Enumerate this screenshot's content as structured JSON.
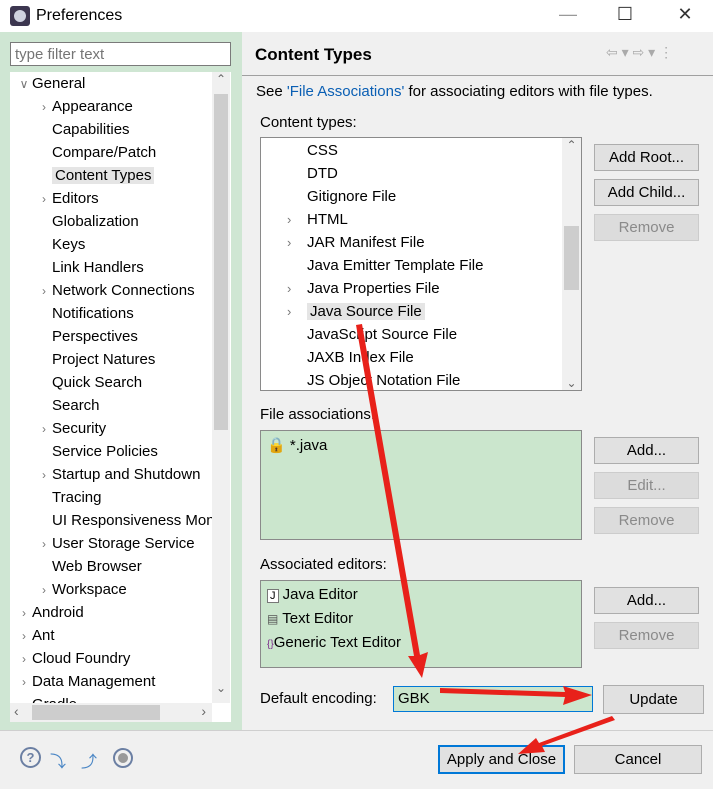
{
  "window": {
    "title": "Preferences",
    "minimize": "—",
    "maximize": "☐",
    "close": "✕"
  },
  "filter": {
    "placeholder": "type filter text"
  },
  "tree": [
    {
      "label": "General",
      "level": 0,
      "exp": "open"
    },
    {
      "label": "Appearance",
      "level": 1,
      "exp": "closed"
    },
    {
      "label": "Capabilities",
      "level": 1,
      "exp": ""
    },
    {
      "label": "Compare/Patch",
      "level": 1,
      "exp": ""
    },
    {
      "label": "Content Types",
      "level": 1,
      "exp": "",
      "selected": true
    },
    {
      "label": "Editors",
      "level": 1,
      "exp": "closed"
    },
    {
      "label": "Globalization",
      "level": 1,
      "exp": ""
    },
    {
      "label": "Keys",
      "level": 1,
      "exp": ""
    },
    {
      "label": "Link Handlers",
      "level": 1,
      "exp": ""
    },
    {
      "label": "Network Connections",
      "level": 1,
      "exp": "closed"
    },
    {
      "label": "Notifications",
      "level": 1,
      "exp": ""
    },
    {
      "label": "Perspectives",
      "level": 1,
      "exp": ""
    },
    {
      "label": "Project Natures",
      "level": 1,
      "exp": ""
    },
    {
      "label": "Quick Search",
      "level": 1,
      "exp": ""
    },
    {
      "label": "Search",
      "level": 1,
      "exp": ""
    },
    {
      "label": "Security",
      "level": 1,
      "exp": "closed"
    },
    {
      "label": "Service Policies",
      "level": 1,
      "exp": ""
    },
    {
      "label": "Startup and Shutdown",
      "level": 1,
      "exp": "closed"
    },
    {
      "label": "Tracing",
      "level": 1,
      "exp": ""
    },
    {
      "label": "UI Responsiveness Monitoring",
      "level": 1,
      "exp": ""
    },
    {
      "label": "User Storage Service",
      "level": 1,
      "exp": "closed"
    },
    {
      "label": "Web Browser",
      "level": 1,
      "exp": ""
    },
    {
      "label": "Workspace",
      "level": 1,
      "exp": "closed"
    },
    {
      "label": "Android",
      "level": 0,
      "exp": "closed"
    },
    {
      "label": "Ant",
      "level": 0,
      "exp": "closed"
    },
    {
      "label": "Cloud Foundry",
      "level": 0,
      "exp": "closed"
    },
    {
      "label": "Data Management",
      "level": 0,
      "exp": "closed"
    },
    {
      "label": "Gradle",
      "level": 0,
      "exp": "closed"
    }
  ],
  "page": {
    "title": "Content Types",
    "see": "See ",
    "link": "'File Associations'",
    "see_rest": " for associating editors with file types.",
    "content_types_label": "Content types:",
    "content_types": [
      {
        "label": "CSS",
        "exp": ""
      },
      {
        "label": "DTD",
        "exp": ""
      },
      {
        "label": "Gitignore File",
        "exp": ""
      },
      {
        "label": "HTML",
        "exp": "closed"
      },
      {
        "label": "JAR Manifest File",
        "exp": "closed"
      },
      {
        "label": "Java Emitter Template File",
        "exp": ""
      },
      {
        "label": "Java Properties File",
        "exp": "closed"
      },
      {
        "label": "Java Source File",
        "exp": "closed",
        "selected": true
      },
      {
        "label": "JavaScript Source File",
        "exp": ""
      },
      {
        "label": "JAXB Index File",
        "exp": ""
      },
      {
        "label": "JS Object Notation File",
        "exp": ""
      }
    ],
    "add_root": "Add Root...",
    "add_child": "Add Child...",
    "remove": "Remove",
    "file_assoc_label": "File associations:",
    "file_assocs": [
      {
        "label": "*.java",
        "icon": "lock-icon"
      }
    ],
    "add": "Add...",
    "edit": "Edit...",
    "assoc_editors_label": "Associated editors:",
    "editors": [
      {
        "label": "Java Editor",
        "icon": "java-editor-icon"
      },
      {
        "label": "Text Editor",
        "icon": "text-editor-icon"
      },
      {
        "label": "Generic Text Editor",
        "icon": "generic-editor-icon"
      }
    ],
    "encoding_label": "Default encoding:",
    "encoding_value": "GBK",
    "update": "Update"
  },
  "footer": {
    "apply_close": "Apply and Close",
    "cancel": "Cancel"
  },
  "colors": {
    "accent": "#0078d7",
    "green": "#cbe6cd",
    "arrow": "#e8211a"
  }
}
